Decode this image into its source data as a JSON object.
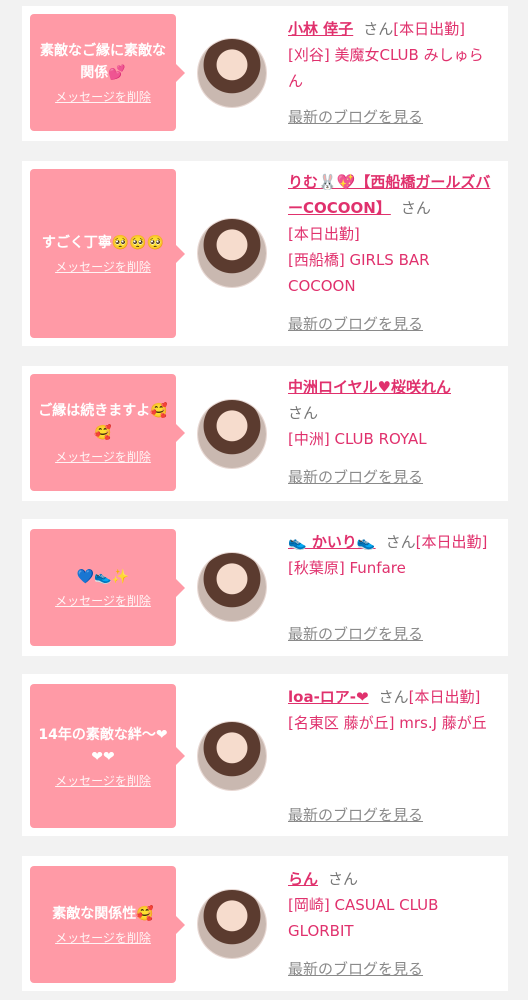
{
  "cards": [
    {
      "message": "素敵なご縁に素敵な関係💕",
      "delete_label": "メッセージを削除",
      "name": "小林 倖子",
      "san": "さん",
      "status": "[本日出勤]",
      "shop": "[刈谷] 美魔女CLUB みしゅらん",
      "blog": "最新のブログを見る"
    },
    {
      "message": "すごく丁寧🥺🥺🥺",
      "delete_label": "メッセージを削除",
      "name": "りむ🐰💖【西船橋ガールズバーCOCOON】",
      "san": "さん",
      "status": "[本日出勤]",
      "shop": "[西船橋] GIRLS BAR COCOON",
      "blog": "最新のブログを見る"
    },
    {
      "message": "ご縁は続きますよ🥰🥰",
      "delete_label": "メッセージを削除",
      "name": "中洲ロイヤル♥桜咲れん",
      "san": "さん",
      "status": "",
      "shop": "[中洲] CLUB ROYAL",
      "blog": "最新のブログを見る"
    },
    {
      "message": "💙👟✨",
      "delete_label": "メッセージを削除",
      "name": "👟 かいり👟",
      "san": "さん",
      "status": "[本日出勤]",
      "shop": "[秋葉原] Funfare",
      "blog": "最新のブログを見る"
    },
    {
      "message": "14年の素敵な絆〜❤❤❤",
      "delete_label": "メッセージを削除",
      "name": "loa-ロア-❤",
      "san": "さん",
      "status": "[本日出勤]",
      "shop": "[名東区 藤が丘] mrs.J 藤が丘",
      "blog": "最新のブログを見る"
    },
    {
      "message": "素敵な関係性🥰",
      "delete_label": "メッセージを削除",
      "name": "らん",
      "san": "さん",
      "status": "",
      "shop": "[岡崎] CASUAL CLUB GLORBIT",
      "blog": "最新のブログを見る"
    }
  ]
}
